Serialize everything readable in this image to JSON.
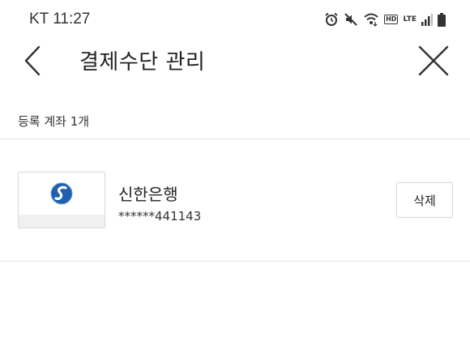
{
  "status_bar": {
    "carrier_time": "KT 11:27",
    "icons": [
      "alarm-icon",
      "mute-icon",
      "wifi-icon",
      "hd-icon",
      "lte-icon",
      "signal-icon",
      "battery-icon"
    ],
    "hd_label": "HD",
    "lte_label": "LTE"
  },
  "header": {
    "title": "결제수단 관리",
    "back_icon": "chevron-left-icon",
    "close_icon": "close-icon"
  },
  "section": {
    "label": "등록 계좌 1개"
  },
  "accounts": [
    {
      "bank_name": "신한은행",
      "account_number": "******441143",
      "logo_icon": "shinhan-logo-icon",
      "delete_label": "삭제"
    }
  ],
  "colors": {
    "divider": "#e3e3e3",
    "logo_blue": "#1f5fae",
    "text": "#222222"
  }
}
